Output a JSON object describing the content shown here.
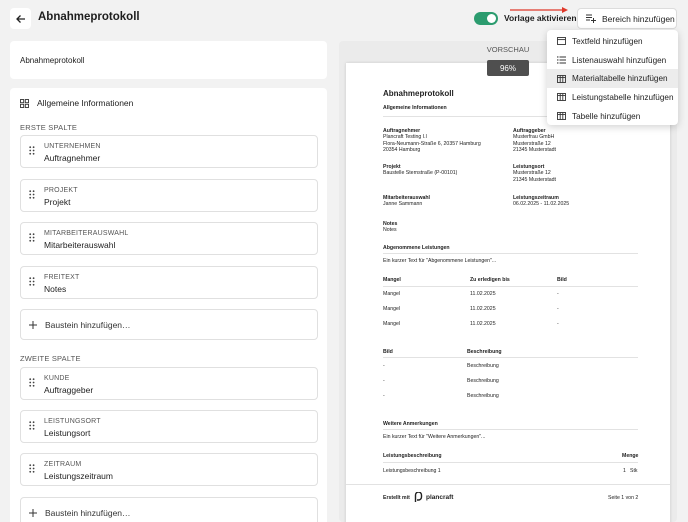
{
  "header": {
    "title": "Abnahmeprotokoll",
    "toggle_label": "Vorlage aktivieren",
    "add_area_label": "Bereich hinzufügen"
  },
  "colors": {
    "accent": "#2c9c6f",
    "arrow": "#e0392b"
  },
  "icons": [
    "back-arrow-icon",
    "playlist-add-icon",
    "grid-icon",
    "drag-grip-icon",
    "plus-icon",
    "textbox-icon",
    "list-icon",
    "table-icon",
    "plancraft-logo-icon"
  ],
  "left": {
    "doc_name": "Abnahmeprotokoll",
    "section_title": "Allgemeine Informationen",
    "first_column_label": "ERSTE SPALTE",
    "second_column_label": "ZWEITE SPALTE",
    "first_items": [
      {
        "label": "UNTERNEHMEN",
        "value": "Auftragnehmer"
      },
      {
        "label": "PROJEKT",
        "value": "Projekt"
      },
      {
        "label": "MITARBEITERAUSWAHL",
        "value": "Mitarbeiterauswahl"
      },
      {
        "label": "FREITEXT",
        "value": "Notes"
      }
    ],
    "second_items": [
      {
        "label": "KUNDE",
        "value": "Auftraggeber"
      },
      {
        "label": "LEISTUNGSORT",
        "value": "Leistungsort"
      },
      {
        "label": "ZEITRAUM",
        "value": "Leistungszeitraum"
      }
    ],
    "add_block_label": "Baustein hinzufügen…"
  },
  "preview": {
    "label": "VORSCHAU",
    "zoom": "96%",
    "doc_title": "Abnahmeprotokoll",
    "section_title": "Allgemeine Informationen",
    "contractor_label": "Auftragnehmer",
    "contractor_value": "Plancraft Testing I.l\nFlora-Neumann-Straße 6, 20357 Hamburg\n20354 Hamburg",
    "client_label": "Auftraggeber",
    "client_value": "Musterfrau GmbH\nMusterstraße 12\n21345 Musterstadt",
    "project_label": "Projekt",
    "project_value": "Baustelle Sternstraße (P-00101)",
    "location_label": "Leistungsort",
    "location_value": "Musterstraße 12\n21345 Musterstadt",
    "staff_label": "Mitarbeiterauswahl",
    "staff_value": "Janne Sammann",
    "period_label": "Leistungszeitraum",
    "period_value": "06.02.2025 - 11.02.2025",
    "notes_label": "Notes",
    "notes_value": "Notes",
    "accepted_title": "Abgenommene Leistungen",
    "accepted_text": "Ein kurzer Text für \"Abgenommene Leistungen\"...",
    "defects_headers": [
      "Mangel",
      "Zu erledigen bis",
      "Bild"
    ],
    "defects_rows": [
      [
        "Mangel",
        "11.02.2025",
        "-"
      ],
      [
        "Mangel",
        "11.02.2025",
        "-"
      ],
      [
        "Mangel",
        "11.02.2025",
        "-"
      ]
    ],
    "image_headers": [
      "Bild",
      "Beschreibung"
    ],
    "image_rows": [
      [
        "-",
        "Beschreibung"
      ],
      [
        "-",
        "Beschreibung"
      ],
      [
        "-",
        "Beschreibung"
      ]
    ],
    "remarks_title": "Weitere Anmerkungen",
    "remarks_text": "Ein kurzer Text für \"Weitere Anmerkungen\"...",
    "service_headers": [
      "Leistungsbeschreibung",
      "Menge"
    ],
    "service_row": [
      "Leistungsbeschreibung 1",
      "1",
      "Stk"
    ],
    "footer_created": "Erstellt mit",
    "footer_brand": "plancraft",
    "footer_page": "Seite 1 von 2"
  },
  "menu": {
    "items": [
      {
        "label": "Textfeld hinzufügen",
        "icon": "textbox-icon"
      },
      {
        "label": "Listenauswahl hinzufügen",
        "icon": "list-icon"
      },
      {
        "label": "Materialtabelle hinzufügen",
        "icon": "table-icon"
      },
      {
        "label": "Leistungstabelle hinzufügen",
        "icon": "table-icon"
      },
      {
        "label": "Tabelle hinzufügen",
        "icon": "table-icon"
      }
    ],
    "highlighted_index": 2
  }
}
